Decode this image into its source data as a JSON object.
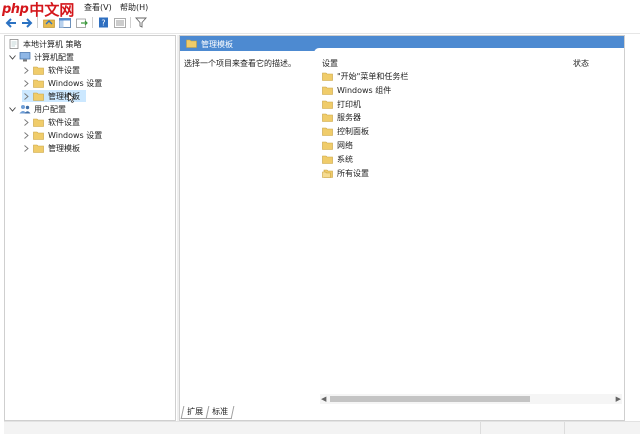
{
  "logo": {
    "php": "php",
    "cn": "中文网"
  },
  "menu": {
    "view": "查看(V)",
    "help": "帮助(H)"
  },
  "tree": {
    "root": "本地计算机 策略",
    "computer_config": "计算机配置",
    "computer_children": [
      "软件设置",
      "Windows 设置",
      "管理模板"
    ],
    "user_config": "用户配置",
    "user_children": [
      "软件设置",
      "Windows 设置",
      "管理模板"
    ]
  },
  "right": {
    "header": "管理模板",
    "description": "选择一个项目来查看它的描述。",
    "col_setting": "设置",
    "col_state": "状态",
    "items": [
      "\"开始\"菜单和任务栏",
      "Windows 组件",
      "打印机",
      "服务器",
      "控制面板",
      "网络",
      "系统",
      "所有设置"
    ]
  },
  "tabs": {
    "extended": "扩展",
    "standard": "标准"
  },
  "colors": {
    "header_blue": "#4d8ad1",
    "folder_yellow": "#f0cc6a",
    "selection": "#cce8ff",
    "logo_red": "#d4161b"
  }
}
